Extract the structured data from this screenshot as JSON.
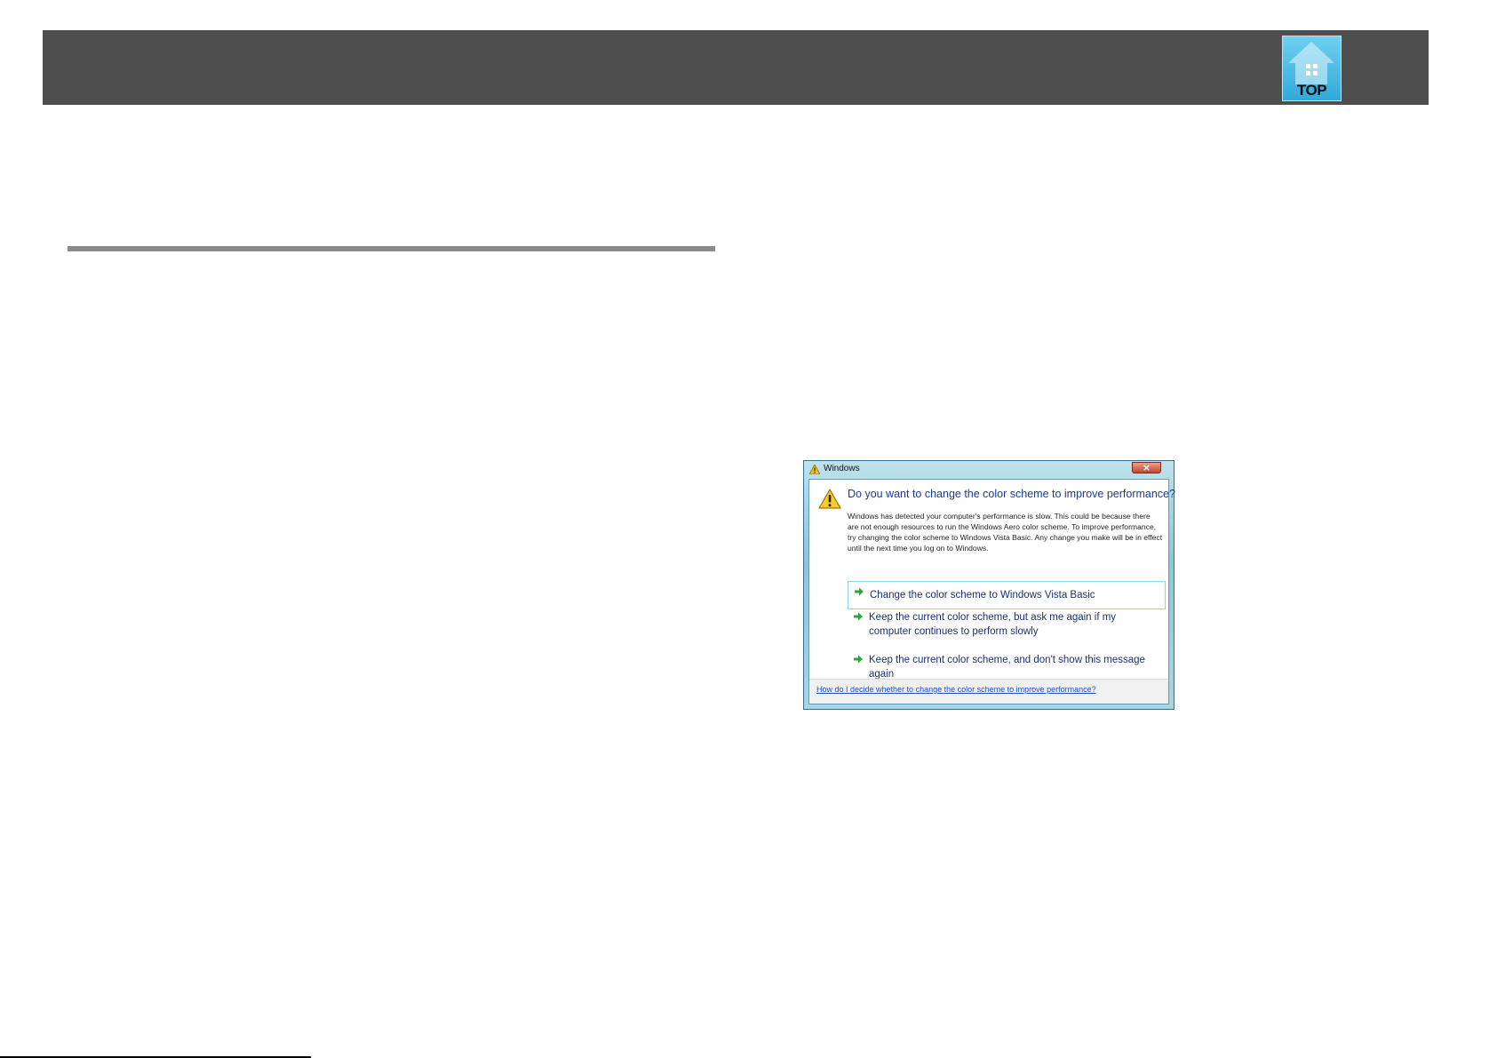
{
  "header": {
    "top_label": "TOP",
    "top_icon": "home-icon",
    "background_color": "#4e4e4e"
  },
  "dialog": {
    "title": "Windows",
    "title_icon": "warning-icon",
    "close_icon": "close-icon",
    "instruction": "Do you want to change the color scheme to improve performance?",
    "body": "Windows has detected your computer's performance is slow. This could be because there are not enough resources to run the Windows Aero color scheme. To improve performance, try changing the color scheme to Windows Vista Basic. Any change you make will be in effect until the next time you log on to Windows.",
    "options": [
      {
        "label": "Change the color scheme to Windows Vista Basic",
        "selected": true
      },
      {
        "label": "Keep the current color scheme, but ask me again if my computer continues to perform slowly",
        "selected": false
      },
      {
        "label": "Keep the current color scheme, and don't show this message again",
        "selected": false
      }
    ],
    "option_icon": "green-arrow-icon",
    "help_link": "How do I decide whether to change the color scheme to improve performance?"
  }
}
